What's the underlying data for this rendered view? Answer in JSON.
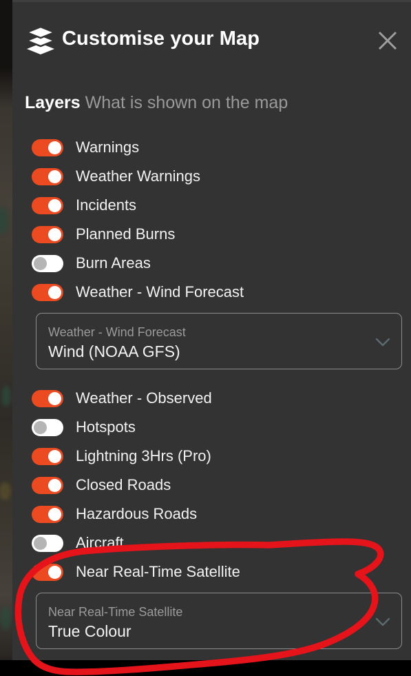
{
  "header": {
    "title": "Customise your Map",
    "layers_icon": "layers-stack-icon",
    "close_icon": "close-icon"
  },
  "section": {
    "title": "Layers",
    "subtitle": "What is shown on the map"
  },
  "layers": [
    {
      "label": "Warnings",
      "state": "on"
    },
    {
      "label": "Weather Warnings",
      "state": "on"
    },
    {
      "label": "Incidents",
      "state": "on"
    },
    {
      "label": "Planned Burns",
      "state": "on"
    },
    {
      "label": "Burn Areas",
      "state": "off"
    },
    {
      "label": "Weather - Wind Forecast",
      "state": "on"
    }
  ],
  "wind_dropdown": {
    "label": "Weather - Wind Forecast",
    "value": "Wind (NOAA GFS)",
    "chevron_icon": "chevron-down-icon"
  },
  "layers_2": [
    {
      "label": "Weather - Observed",
      "state": "on"
    },
    {
      "label": "Hotspots",
      "state": "off"
    },
    {
      "label": "Lightning 3Hrs (Pro)",
      "state": "on"
    },
    {
      "label": "Closed Roads",
      "state": "on"
    },
    {
      "label": "Hazardous Roads",
      "state": "on"
    },
    {
      "label": "Aircraft",
      "state": "off"
    },
    {
      "label": "Near Real-Time Satellite",
      "state": "on"
    }
  ],
  "satellite_dropdown": {
    "label": "Near Real-Time Satellite",
    "value": "True Colour",
    "chevron_icon": "chevron-down-icon"
  },
  "colors": {
    "panel_background": "#333333",
    "toggle_on": "#ec4a20",
    "toggle_off_track": "#ffffff",
    "toggle_off_knob": "#b5b5b5",
    "text_primary": "#f2f2f2",
    "text_muted": "#9a9a9a",
    "annotation_red": "#e4141a"
  },
  "annotation": {
    "shape": "hand-drawn-red-ellipse",
    "encircles": "Near Real-Time Satellite toggle and True Colour dropdown"
  }
}
